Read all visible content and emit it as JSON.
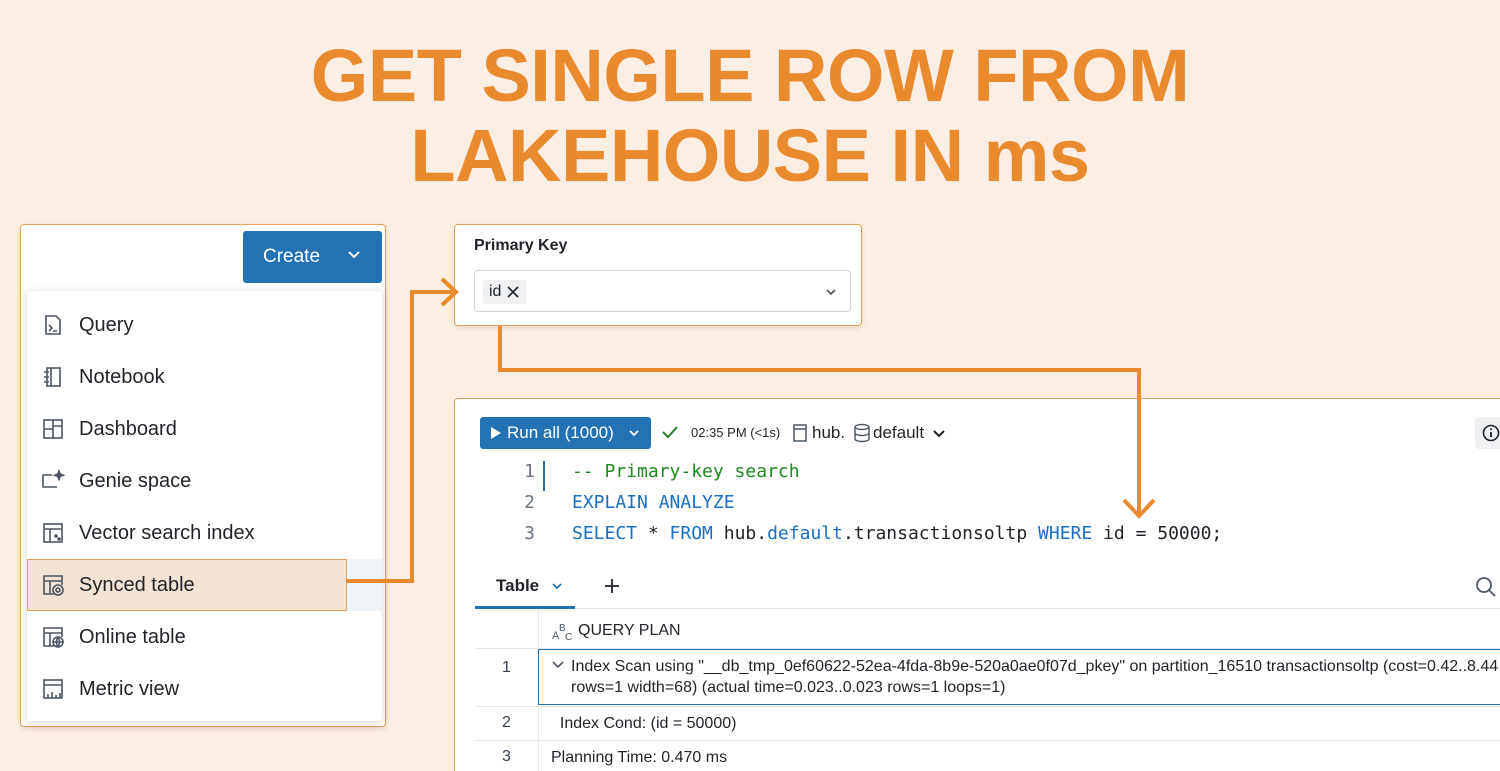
{
  "title": {
    "line1": "GET SINGLE ROW FROM",
    "line2": "LAKEHOUSE IN ms"
  },
  "colors": {
    "accent": "#e98a2f",
    "primary_button": "#2272b4",
    "background": "#fdeee3"
  },
  "create_menu": {
    "button_label": "Create",
    "items": [
      {
        "label": "Query",
        "icon": "query-icon"
      },
      {
        "label": "Notebook",
        "icon": "notebook-icon"
      },
      {
        "label": "Dashboard",
        "icon": "dashboard-icon"
      },
      {
        "label": "Genie space",
        "icon": "genie-icon"
      },
      {
        "label": "Vector search index",
        "icon": "vector-index-icon"
      },
      {
        "label": "Synced table",
        "icon": "synced-table-icon",
        "selected": true
      },
      {
        "label": "Online table",
        "icon": "online-table-icon"
      },
      {
        "label": "Metric view",
        "icon": "metric-view-icon"
      }
    ]
  },
  "primary_key": {
    "label": "Primary Key",
    "chip": "id"
  },
  "editor": {
    "run_label": "Run all (1000)",
    "run_time": "02:35 PM (<1s)",
    "catalog": "hub",
    "separator": ".",
    "schema": "default",
    "lines": [
      {
        "num": "1",
        "parts": [
          {
            "t": "-- Primary-key search",
            "c": "comment"
          }
        ]
      },
      {
        "num": "2",
        "parts": [
          {
            "t": "EXPLAIN ANALYZE",
            "c": "kw"
          }
        ]
      },
      {
        "num": "3",
        "parts": [
          {
            "t": "SELECT",
            "c": "kw"
          },
          {
            "t": " * ",
            "c": "plain"
          },
          {
            "t": "FROM",
            "c": "kw"
          },
          {
            "t": " hub.",
            "c": "plain"
          },
          {
            "t": "default",
            "c": "kw"
          },
          {
            "t": ".transactionsoltp ",
            "c": "plain"
          },
          {
            "t": "WHERE",
            "c": "kw"
          },
          {
            "t": " id = 50000;",
            "c": "plain"
          }
        ]
      }
    ]
  },
  "results": {
    "tab_label": "Table",
    "column_type_icon": "text-type-icon",
    "column_name": "QUERY PLAN",
    "rows": [
      {
        "num": "1",
        "line1": "Index Scan using \"__db_tmp_0ef60622-52ea-4fda-8b9e-520a0ae0f07d_pkey\" on partition_16510 transactionsoltp  (cost=0.42..8.44",
        "line2": "rows=1 width=68) (actual time=0.023..0.023 rows=1 loops=1)"
      },
      {
        "num": "2",
        "text": "  Index Cond: (id = 50000)"
      },
      {
        "num": "3",
        "text": "Planning Time: 0.470 ms"
      }
    ]
  }
}
